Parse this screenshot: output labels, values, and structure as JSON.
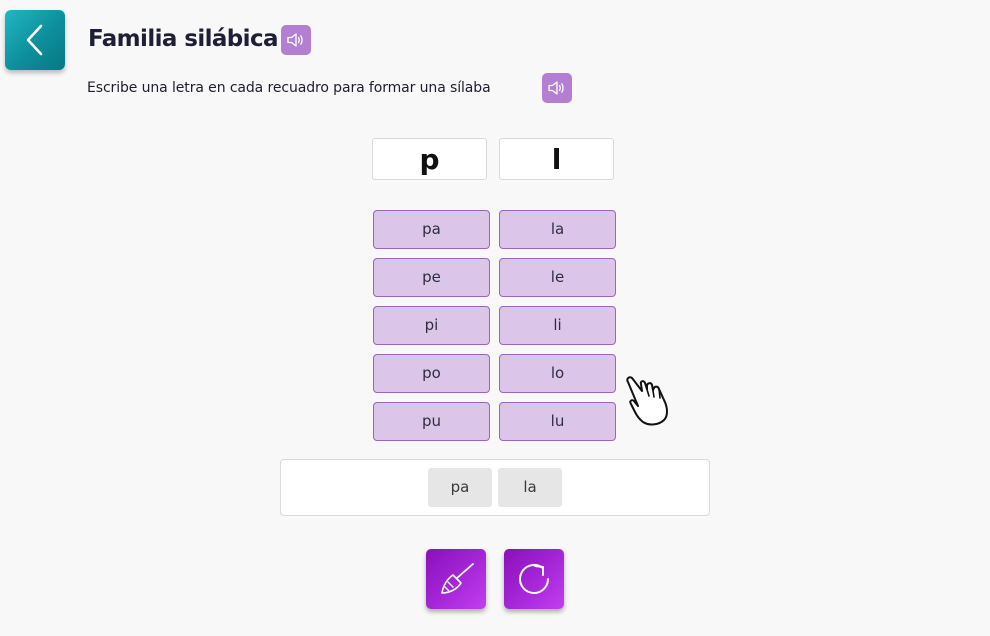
{
  "header": {
    "title": "Familia silábica",
    "back_icon": "chevron-left-icon",
    "speaker_icon": "speaker-icon"
  },
  "instruction": {
    "text": "Escribe una letra en cada recuadro para formar una sílaba"
  },
  "letter_inputs": [
    {
      "value": "p"
    },
    {
      "value": "l"
    }
  ],
  "syllables": {
    "column_1": [
      "pa",
      "pe",
      "pi",
      "po",
      "pu"
    ],
    "column_2": [
      "la",
      "le",
      "li",
      "lo",
      "lu"
    ]
  },
  "result": {
    "chips": [
      "pa",
      "la"
    ]
  },
  "actions": {
    "clear_icon": "broom-icon",
    "redo_icon": "redo-icon"
  },
  "colors": {
    "back_button": "#0e8e9c",
    "speaker_button": "#b27fd3",
    "syllable_fill": "#dbc6e9",
    "syllable_border": "#9e62c4",
    "action_button": "#a325d6"
  }
}
